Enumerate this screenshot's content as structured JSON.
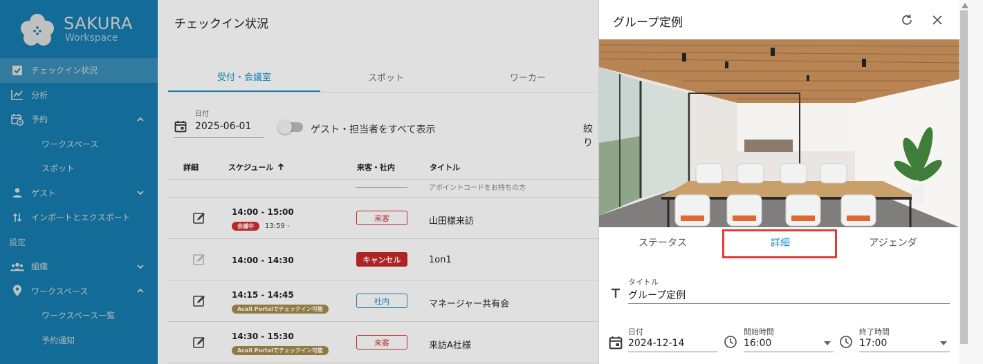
{
  "brand": {
    "name": "SAKURA",
    "sub": "Workspace"
  },
  "colors": {
    "primary": "#1a8fc9",
    "danger": "#d32f2f",
    "highlight": "#e53935"
  },
  "sidebar": {
    "items": [
      {
        "label": "チェックイン状況",
        "icon": "checkbox-icon"
      },
      {
        "label": "分析",
        "icon": "chart-icon"
      },
      {
        "label": "予約",
        "icon": "calendar-clock-icon"
      },
      {
        "label": "ワークスペース"
      },
      {
        "label": "スポット"
      },
      {
        "label": "ゲスト",
        "icon": "person-icon"
      },
      {
        "label": "インポートとエクスポート",
        "icon": "import-export-icon"
      },
      {
        "label": "組織",
        "icon": "group-icon"
      },
      {
        "label": "ワークスペース",
        "icon": "location-pin-icon"
      },
      {
        "label": "ワークスペース一覧"
      },
      {
        "label": "予約通知"
      }
    ],
    "section_settings": "設定"
  },
  "main": {
    "title": "チェックイン状況",
    "tabs": [
      "受付・会議室",
      "スポット",
      "ワーカー"
    ],
    "date_label": "日付",
    "date_value": "2025-06-01",
    "toggle_label": "ゲスト・担当者をすべて表示",
    "filter_cut": "絞り",
    "columns": {
      "detail": "詳細",
      "schedule": "スケジュール",
      "visitor": "来客・社内",
      "title": "タイトル"
    },
    "cut_text": "アポイントコードをお持ちの方",
    "rows": [
      {
        "time": "14:00 - 15:00",
        "pill": "会議中",
        "subtime": "13:59 -",
        "badge": "来客",
        "title": "山田様来訪"
      },
      {
        "time": "14:00 - 14:30",
        "badge": "キャンセル",
        "title": "1on1"
      },
      {
        "time": "14:15 - 14:45",
        "pill": "Acall Portalでチェックイン可能",
        "badge": "社内",
        "title": "マネージャー共有会"
      },
      {
        "time": "14:30 - 15:30",
        "pill": "Acall Portalでチェックイン可能",
        "badge": "来客",
        "title": "来訪A社様"
      }
    ]
  },
  "drawer": {
    "title": "グループ定例",
    "tabs": [
      "ステータス",
      "詳細",
      "アジェンダ"
    ],
    "fields": {
      "title_label": "タイトル",
      "title_value": "グループ定例",
      "date_label": "日付",
      "date_value": "2024-12-14",
      "start_label": "開始時間",
      "start_value": "16:00",
      "end_label": "終了時間",
      "end_value": "17:00"
    }
  }
}
